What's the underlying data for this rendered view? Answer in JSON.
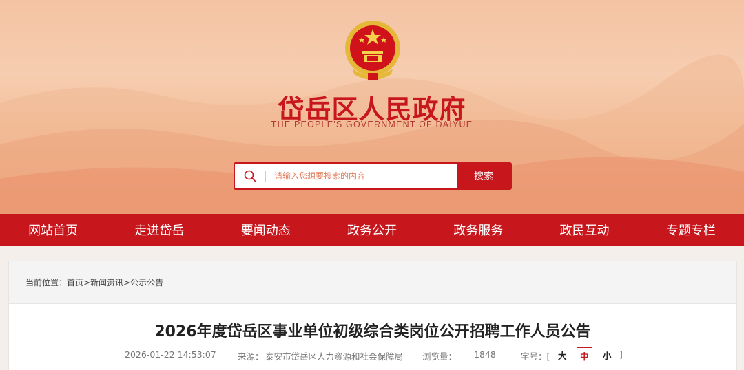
{
  "header": {
    "title": "岱岳区人民政府",
    "subtitle": "THE PEOPLE'S GOVERNMENT OF DAIYUE"
  },
  "search": {
    "placeholder": "请输入您想要搜索的内容",
    "button_label": "搜索"
  },
  "nav": {
    "items": [
      "网站首页",
      "走进岱岳",
      "要闻动态",
      "政务公开",
      "政务服务",
      "政民互动",
      "专题专栏"
    ]
  },
  "breadcrumb": {
    "text": "当前位置：首页>新闻资讯>公示公告"
  },
  "article": {
    "title": "2026年度岱岳区事业单位初级综合类岗位公开招聘工作人员公告",
    "date": "2026-01-22 14:53:07",
    "source_label": "来源：",
    "source": "泰安市岱岳区人力资源和社会保障局",
    "views_label": "浏览量：",
    "views": "1848",
    "font_size_label": "字号：[",
    "font_size_close": "]",
    "font_sizes": [
      "大",
      "中",
      "小"
    ],
    "font_size_selected": "中"
  },
  "colors": {
    "brand_red": "#c8161d",
    "banner_peach": "#f4c3a3"
  },
  "icons": [
    "national-emblem-icon",
    "search-icon"
  ]
}
